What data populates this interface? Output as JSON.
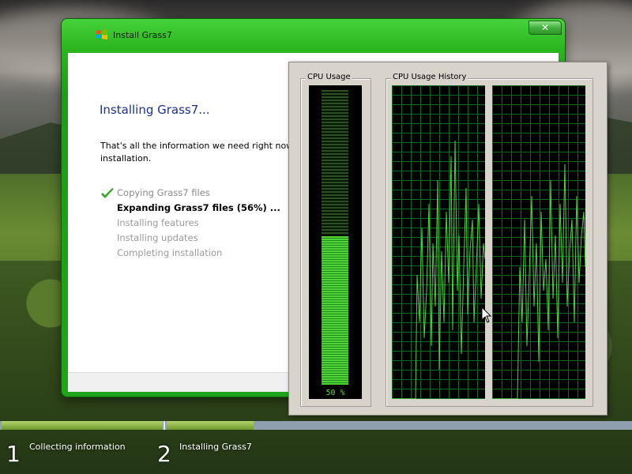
{
  "installer": {
    "window_title": "Install Grass7",
    "heading": "Installing Grass7...",
    "description": "That's all the information we need right now.\ninstallation.",
    "close_label": "✕",
    "steps": [
      {
        "label": "Copying Grass7 files",
        "status": "done"
      },
      {
        "label": "Expanding Grass7 files (56%) ...",
        "status": "current"
      },
      {
        "label": "Installing features",
        "status": "pending"
      },
      {
        "label": "Installing updates",
        "status": "pending"
      },
      {
        "label": "Completing installation",
        "status": "pending"
      }
    ]
  },
  "cpu_monitor": {
    "usage_title": "CPU Usage",
    "history_title": "CPU Usage History",
    "usage_value": "50 %",
    "usage_fraction": 0.5,
    "accent_color": "#4fd339",
    "grid_color": "#0d6b1e"
  },
  "setup_stages": [
    {
      "number": "1",
      "label": "Collecting information",
      "progress_fraction": 1.0
    },
    {
      "number": "2",
      "label": "Installing Grass7",
      "progress_fraction": 0.19
    }
  ]
}
